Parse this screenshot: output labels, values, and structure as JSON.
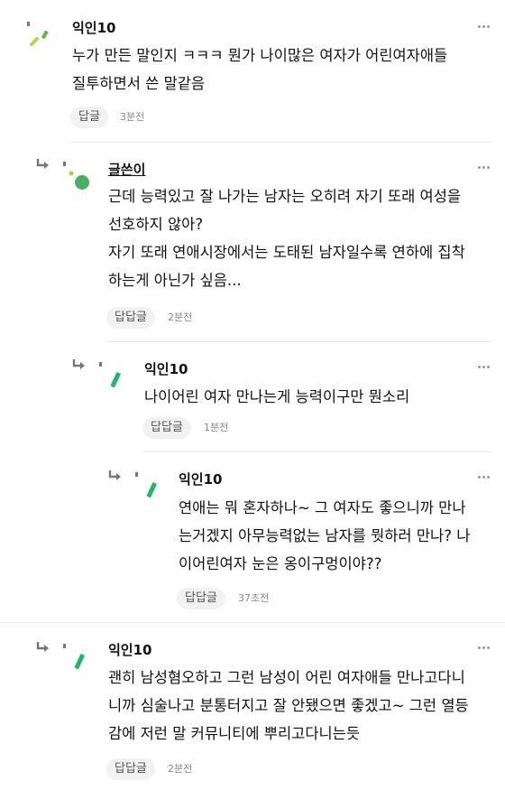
{
  "comments": [
    {
      "nickname": "익인10",
      "lines": [
        "누가 만든 말인지 ㅋㅋㅋ 뭔가 나이많은 여자가 어린여자애들",
        "질투하면서 쓴 말같음"
      ],
      "reply_label": "답글",
      "time": "3분전",
      "avatar_colors": [
        "#b3d94a",
        "#5dbb3c"
      ]
    },
    {
      "nickname": "글쓴이",
      "is_author": true,
      "lines": [
        "근데 능력있고 잘 나가는 남자는 오히려 자기 또래 여성을",
        "선호하지 않아?",
        "자기 또래 연애시장에서는 도태된 남자일수록 연하에 집착",
        "하는게 아닌가 싶음..."
      ],
      "reply_label": "답답글",
      "time": "2분전",
      "avatar_colors": [
        "#a3d63c",
        "#47b060"
      ]
    },
    {
      "nickname": "익인10",
      "lines": [
        "나이어린 여자 만나는게 능력이구만 뭔소리"
      ],
      "reply_label": "답답글",
      "time": "1분전",
      "avatar_colors": [
        "#1fb86a"
      ]
    },
    {
      "nickname": "익인10",
      "lines": [
        "연애는 뭐 혼자하나~ 그 여자도 좋으니까 만나",
        "는거겠지 아무능력없는 남자를 뭣하러 만나? 나",
        "이어린여자 눈은 옹이구멍이야??"
      ],
      "reply_label": "답답글",
      "time": "37초전",
      "avatar_colors": [
        "#1fb86a"
      ]
    },
    {
      "nickname": "익인10",
      "lines": [
        "괜히 남성혐오하고 그런 남성이 어린 여자애들 만나고다니",
        "니까 심술나고 분통터지고 잘 안됐으면 좋겠고~ 그런 열등",
        "감에 저런 말 커뮤니티에 뿌리고다니는듯"
      ],
      "reply_label": "답답글",
      "time": "2분전",
      "avatar_colors": [
        "#1fb86a"
      ]
    }
  ],
  "icons": {
    "reply_arrow": "reply-arrow-icon",
    "more": "more-dots-icon"
  }
}
